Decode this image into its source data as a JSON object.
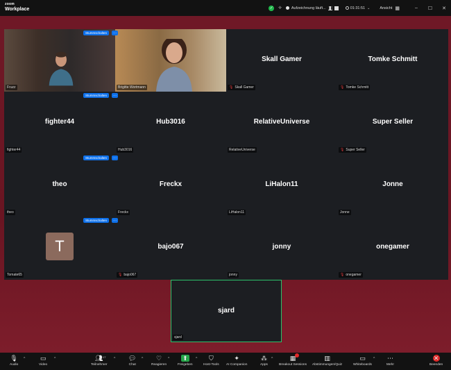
{
  "app": {
    "logo_line1": "zoom",
    "logo_line2": "Workplace"
  },
  "titlebar": {
    "recording_label": "Aufzeichnung läuft...",
    "timer": "01:31:51",
    "view_label": "Ansicht"
  },
  "controls": {
    "spotlight_label": "Stummschalten",
    "more_label": "···"
  },
  "participants": [
    {
      "name": "Fruzz",
      "show_name": false,
      "muted": false,
      "video": true
    },
    {
      "name": "Brigitte Wortmann",
      "show_name": false,
      "muted": false,
      "video": true
    },
    {
      "name": "Skall Gamer",
      "show_name": true,
      "muted": true,
      "video": false
    },
    {
      "name": "Tomke Schmitt",
      "show_name": true,
      "muted": true,
      "video": false
    },
    {
      "name": "fighter44",
      "show_name": true,
      "muted": false,
      "video": false
    },
    {
      "name": "Hub3016",
      "show_name": true,
      "muted": false,
      "video": false
    },
    {
      "name": "RelativeUniverse",
      "show_name": true,
      "muted": false,
      "video": false
    },
    {
      "name": "Super Seller",
      "show_name": true,
      "muted": true,
      "video": false
    },
    {
      "name": "theo",
      "show_name": true,
      "muted": false,
      "video": false
    },
    {
      "name": "Freckx",
      "show_name": true,
      "muted": false,
      "video": false
    },
    {
      "name": "LiHalon11",
      "show_name": true,
      "muted": false,
      "video": false
    },
    {
      "name": "Jonne",
      "show_name": true,
      "muted": false,
      "video": false
    },
    {
      "name": "Tomate65",
      "avatar_letter": "T",
      "show_name": false,
      "muted": false,
      "video": false
    },
    {
      "name": "bajo067",
      "show_name": true,
      "muted": true,
      "video": false
    },
    {
      "name": "jonny",
      "show_name": true,
      "muted": false,
      "video": false
    },
    {
      "name": "onegamer",
      "show_name": true,
      "muted": true,
      "video": false
    }
  ],
  "self": {
    "name": "sjard"
  },
  "toolbar": {
    "audio": "Audio",
    "video": "Video",
    "participants": "Teilnehmer",
    "participants_count": "17",
    "chat": "Chat",
    "react": "Reagieren",
    "share": "Freigeben",
    "host_tools": "Host-Tools",
    "ai_companion": "AI Companion",
    "apps": "Apps",
    "breakout": "Breakout Sessions",
    "polls": "Abstimmungen/Quiz",
    "whiteboards": "Whiteboards",
    "more": "Mehr",
    "end": "Beenden"
  },
  "colors": {
    "accent": "#0e71eb",
    "end": "#e02828",
    "share": "#26a64a",
    "selfview_border": "#2cc36b"
  }
}
